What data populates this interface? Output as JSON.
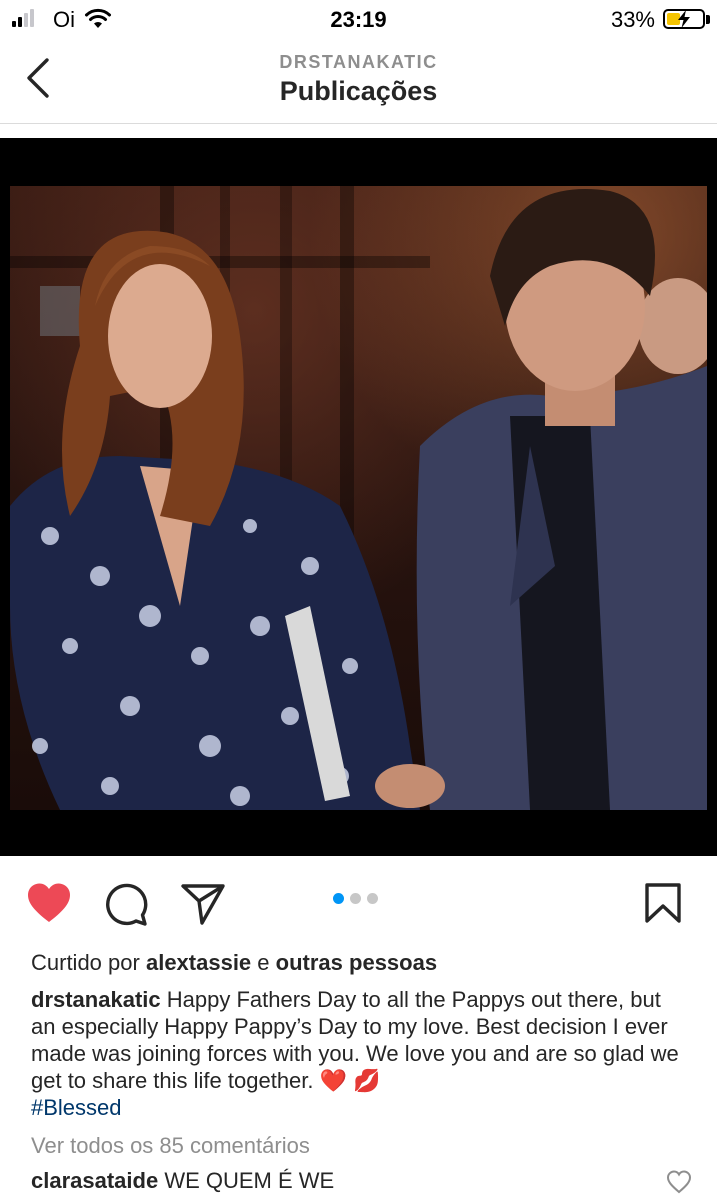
{
  "status_bar": {
    "carrier": "Oi",
    "time": "23:19",
    "battery_percent": "33%",
    "battery_level": 0.33,
    "signal_bars": 2,
    "signal_bars_total": 4
  },
  "header": {
    "username": "DRSTANAKATIC",
    "title": "Publicações"
  },
  "post": {
    "image_icon": "photo",
    "carousel_total": 3,
    "carousel_active": 1,
    "liked": true,
    "like_color": "#ed4956",
    "likes": {
      "prefix": "Curtido por",
      "user": "alextassie",
      "connector": "e",
      "others": "outras pessoas"
    },
    "caption": {
      "author": "drstanakatic",
      "text": "Happy Fathers Day to all the Pappys out there, but an especially Happy Pappy’s Day to my love. Best decision I ever made was joining forces with you. We love you and are so glad we get to share this life together. ❤️ 💋",
      "hashtag": "#Blessed"
    },
    "view_comments": "Ver todos os 85 comentários",
    "preview_comment": {
      "user": "clarasataide",
      "text": "WE QUEM É WE"
    }
  },
  "icons": {
    "back": "chevron-left-icon",
    "like": "heart-icon",
    "comment": "comment-icon",
    "share": "paper-plane-icon",
    "save": "bookmark-icon"
  }
}
